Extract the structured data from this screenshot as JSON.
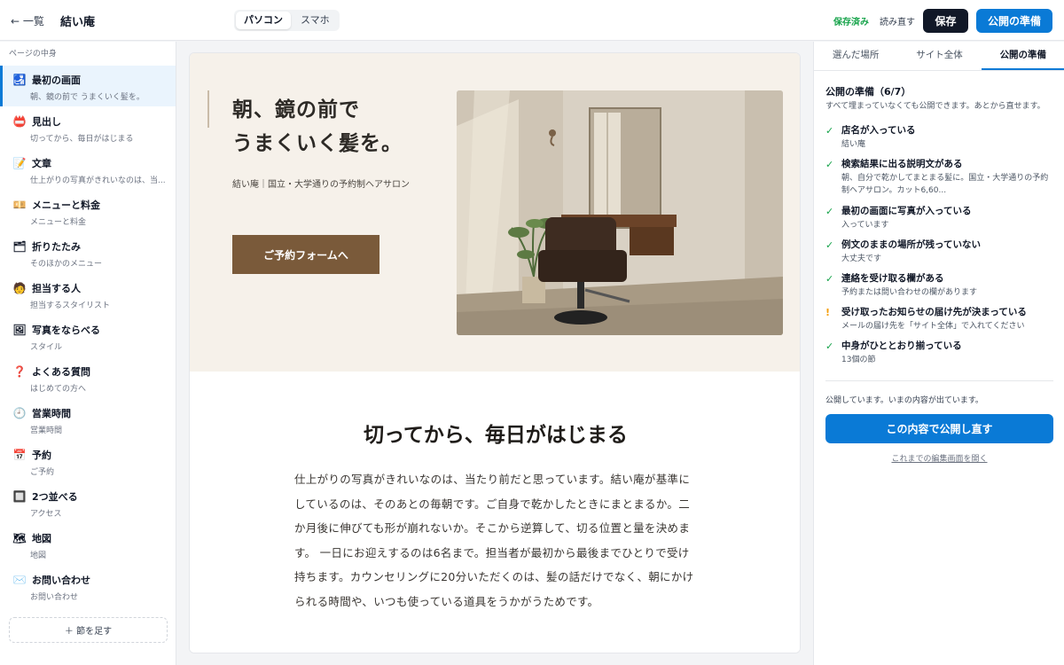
{
  "topbar": {
    "back_label": "← 一覧",
    "site_name": "結い庵",
    "device_options": [
      "パソコン",
      "スマホ"
    ],
    "device_selected": "パソコン",
    "saved_status": "保存済み",
    "reload_label": "読み直す",
    "save_label": "保存",
    "publish_label": "公開の準備"
  },
  "sidebar": {
    "title": "ページの中身",
    "items": [
      {
        "icon": "🛃",
        "icon_name": "hero-icon",
        "label": "最初の画面",
        "sub": "朝、鏡の前で うまくいく髪を。",
        "active": true
      },
      {
        "icon": "📛",
        "icon_name": "heading-icon",
        "label": "見出し",
        "sub": "切ってから、毎日がはじまる"
      },
      {
        "icon": "📝",
        "icon_name": "memo-icon",
        "label": "文章",
        "sub": "仕上がりの写真がきれいなのは、当..."
      },
      {
        "icon": "💴",
        "icon_name": "money-icon",
        "label": "メニューと料金",
        "sub": "メニューと料金"
      },
      {
        "icon": "🗂",
        "icon_name": "folder-icon",
        "label": "折りたたみ",
        "sub": "そのほかのメニュー"
      },
      {
        "icon": "🧑",
        "icon_name": "person-icon",
        "label": "担当する人",
        "sub": "担当するスタイリスト"
      },
      {
        "icon": "🖼",
        "icon_name": "picture-icon",
        "label": "写真をならべる",
        "sub": "スタイル"
      },
      {
        "icon": "❓",
        "icon_name": "question-icon",
        "label": "よくある質問",
        "sub": "はじめての方へ"
      },
      {
        "icon": "🕘",
        "icon_name": "clock-icon",
        "label": "営業時間",
        "sub": "営業時間"
      },
      {
        "icon": "📅",
        "icon_name": "calendar-icon",
        "label": "予約",
        "sub": "ご予約"
      },
      {
        "icon": "🔲",
        "icon_name": "columns-icon",
        "label": "2つ並べる",
        "sub": "アクセス"
      },
      {
        "icon": "🗺",
        "icon_name": "map-icon",
        "label": "地図",
        "sub": "地図"
      },
      {
        "icon": "✉️",
        "icon_name": "mail-icon",
        "label": "お問い合わせ",
        "sub": "お問い合わせ"
      }
    ],
    "add_label": "＋ 節を足す"
  },
  "preview": {
    "hero_line1": "朝、鏡の前で",
    "hero_line2": "うまくいく髪を。",
    "hero_sub": "結い庵｜国立・大学通りの予約制ヘアサロン",
    "hero_cta": "ご予約フォームへ",
    "section_heading": "切ってから、毎日がはじまる",
    "section_body": "仕上がりの写真がきれいなのは、当たり前だと思っています。結い庵が基準にしているのは、そのあとの毎朝です。ご自身で乾かしたときにまとまるか。二か月後に伸びても形が崩れないか。そこから逆算して、切る位置と量を決めます。 一日にお迎えするのは6名まで。担当者が最初から最後までひとりで受け持ちます。カウンセリングに20分いただくのは、髪の話だけでなく、朝にかけられる時間や、いつも使っている道具をうかがうためです。"
  },
  "right_panel": {
    "tabs": [
      "選んだ場所",
      "サイト全体",
      "公開の準備"
    ],
    "active_tab": "公開の準備",
    "title": "公開の準備（6/7）",
    "desc": "すべて埋まっていなくても公開できます。あとから直せます。",
    "checks": [
      {
        "status": "ok",
        "mark": "✓",
        "title": "店名が入っている",
        "detail": "結い庵"
      },
      {
        "status": "ok",
        "mark": "✓",
        "title": "検索結果に出る説明文がある",
        "detail": "朝、自分で乾かしてまとまる髪に。国立・大学通りの予約制ヘアサロン。カット6,60..."
      },
      {
        "status": "ok",
        "mark": "✓",
        "title": "最初の画面に写真が入っている",
        "detail": "入っています"
      },
      {
        "status": "ok",
        "mark": "✓",
        "title": "例文のままの場所が残っていない",
        "detail": "大丈夫です"
      },
      {
        "status": "ok",
        "mark": "✓",
        "title": "連絡を受け取る欄がある",
        "detail": "予約または問い合わせの欄があります"
      },
      {
        "status": "warn",
        "mark": "!",
        "title": "受け取ったお知らせの届け先が決まっている",
        "detail": "メールの届け先を「サイト全体」で入れてください"
      },
      {
        "status": "ok",
        "mark": "✓",
        "title": "中身がひととおり揃っている",
        "detail": "13個の節"
      }
    ],
    "status_text": "公開しています。いまの内容が出ています。",
    "republish_label": "この内容で公開し直す",
    "history_link": "これまでの編集画面を開く"
  },
  "colors": {
    "accent": "#0a7ad6",
    "dark_button": "#111827",
    "cta_brown": "#7a5a3a",
    "hero_bg": "#f6f1ea",
    "ok_green": "#16a34a",
    "warn_amber": "#f59e0b"
  }
}
